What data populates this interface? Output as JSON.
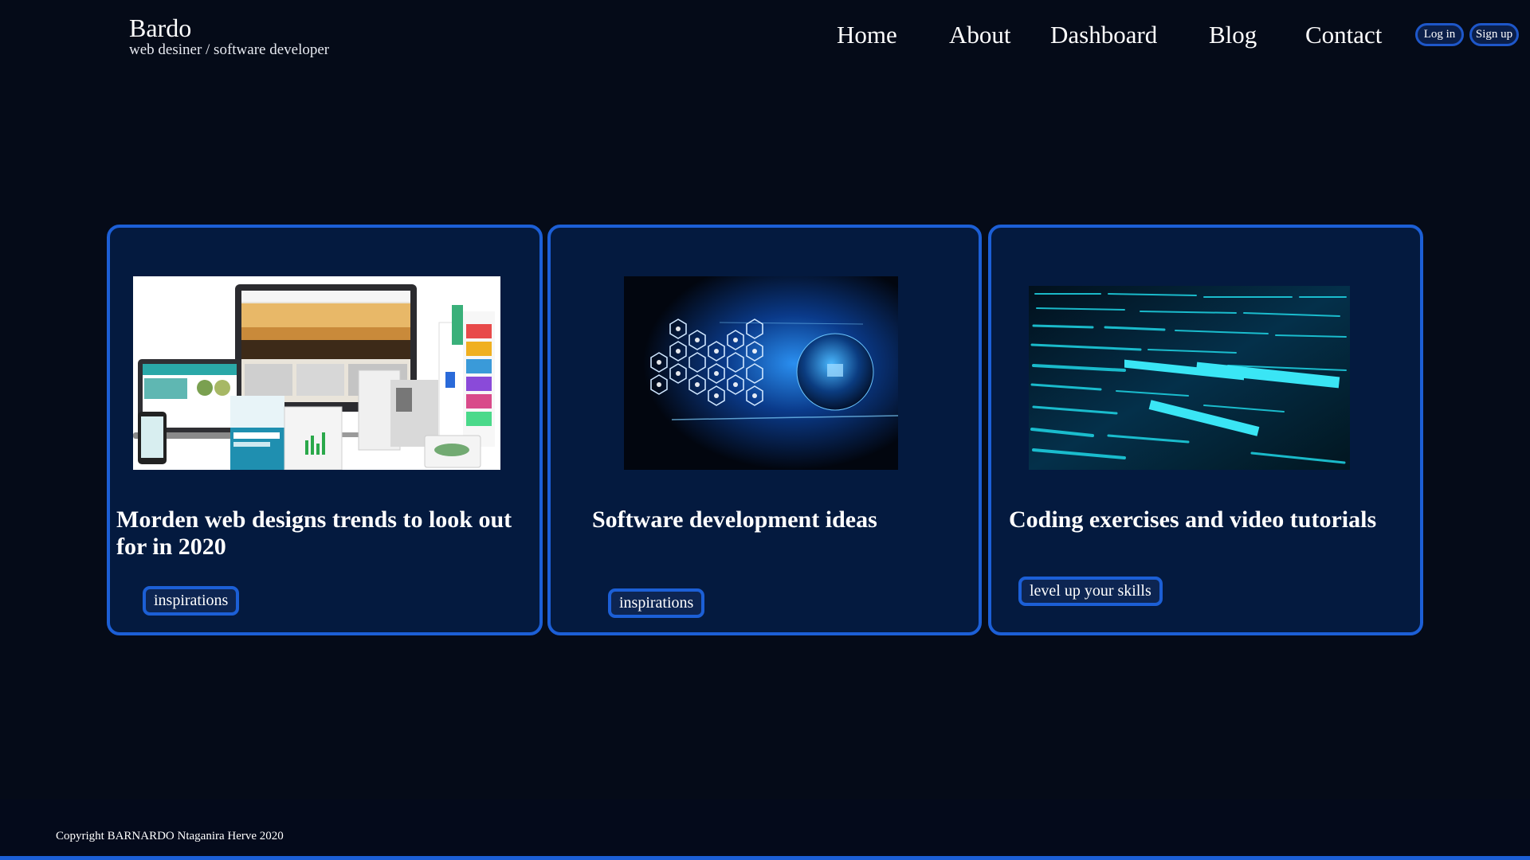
{
  "header": {
    "brand_name": "Bardo",
    "brand_tagline": "web desiner / software developer",
    "nav": {
      "home": "Home",
      "about": "About",
      "dashboard": "Dashboard",
      "blog": "Blog",
      "contact": "Contact"
    },
    "login_label": "Log in",
    "signup_label": "Sign up"
  },
  "cards": [
    {
      "title": "Morden web designs trends to look out for in 2020",
      "tag": "inspirations"
    },
    {
      "title": "Software development ideas",
      "tag": "inspirations"
    },
    {
      "title": "Coding exercises and video tutorials",
      "tag": "level up your skills"
    }
  ],
  "footer": {
    "copyright": "Copyright BARNARDO Ntaganira Herve 2020"
  },
  "colors": {
    "background": "#050b18",
    "card_background": "#041a3f",
    "accent_border": "#1c5fd6"
  }
}
